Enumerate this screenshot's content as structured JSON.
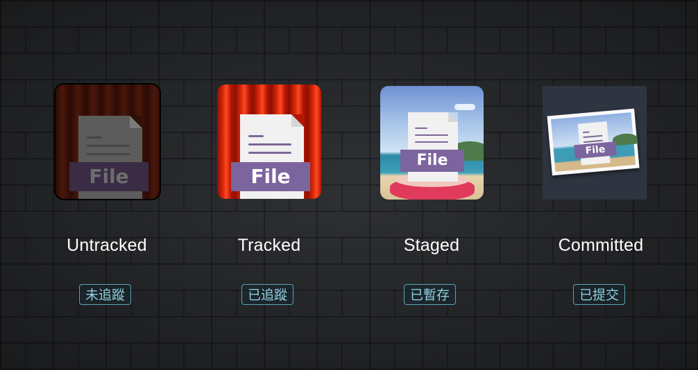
{
  "stages": [
    {
      "title": "Untracked",
      "badge": "未追蹤",
      "file_label": "File"
    },
    {
      "title": "Tracked",
      "badge": "已追蹤",
      "file_label": "File"
    },
    {
      "title": "Staged",
      "badge": "已暫存",
      "file_label": "File"
    },
    {
      "title": "Committed",
      "badge": "已提交",
      "file_label": "File"
    }
  ],
  "colors": {
    "background": "#26282b",
    "badge_border": "#5aa6b8",
    "badge_text": "#8fd0e0",
    "file_banner": "#7c649e",
    "curtain_red": "#d41e08"
  },
  "icons": [
    "dark-curtain-file-icon",
    "red-curtain-file-icon",
    "beach-podium-file-icon",
    "framed-photo-file-icon"
  ]
}
